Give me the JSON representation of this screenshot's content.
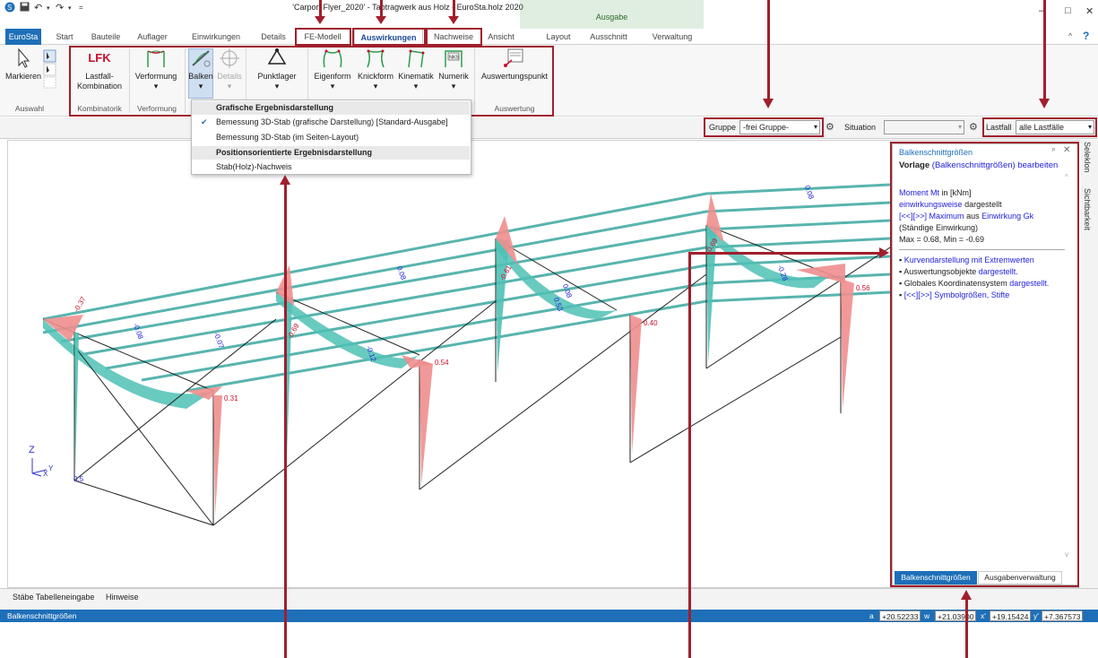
{
  "window": {
    "title": "'Carport Flyer_2020' - Tabtragwerk aus Holz - EuroSta.holz 2020",
    "ausgabe_group": "Ausgabe",
    "help": "?"
  },
  "tabs": [
    "EuroSta",
    "Start",
    "Bauteile",
    "Auflager",
    "Einwirkungen",
    "Details",
    "FE-Modell",
    "Auswirkungen",
    "Nachweise",
    "Ansicht",
    "Layout",
    "Ausschnitt",
    "Verwaltung"
  ],
  "ribbon": {
    "markieren": "Markieren",
    "auswahl": "Auswahl",
    "lfk_icon": "LFK",
    "lastfall_line1": "Lastfall-",
    "lastfall_line2": "Kombination",
    "kombinatorik": "Kombinatorik",
    "verformung": "Verformung",
    "verformung_group": "Verformung",
    "balken": "Balken",
    "details": "Details",
    "punktlager": "Punktlager",
    "eigenform": "Eigenform",
    "knickform": "Knickform",
    "kinematik": "Kinematik",
    "numerik": "Numerik",
    "nks_icon": "NKS",
    "auswertungspunkt": "Auswertungspunkt",
    "auswertung": "Auswertung"
  },
  "menu": {
    "hdr1": "Grafische Ergebnisdarstellung",
    "item1": "Bemessung 3D-Stab (grafische Darstellung) [Standard-Ausgabe]",
    "item2": "Bemessung 3D-Stab (im Seiten-Layout)",
    "hdr2": "Positionsorientierte Ergebnisdarstellung",
    "item3": "Stab(Holz)-Nachweis",
    "check": "✔"
  },
  "filter": {
    "gruppe_label": "Gruppe",
    "gruppe_value": "-frei Gruppe-",
    "situation_label": "Situation",
    "situation_value": "",
    "lastfall_label": "Lastfall",
    "lastfall_value": "alle Lastfälle"
  },
  "panel": {
    "title": "Balkenschnittgrößen",
    "vorlage_a": "Vorlage",
    "vorlage_b": "(Balkenschnittgrößen)",
    "vorlage_c": "bearbeiten",
    "line1a": "Moment Mt",
    "line1b": "in [kNm]",
    "line2a": "einwirkungsweise",
    "line2b": "dargestellt",
    "line3a": "[<<][>>]",
    "line3b": "Maximum",
    "line3c": "aus",
    "line3d": "Einwirkung Gk",
    "line4": "(Ständige Einwirkung)",
    "line5": "Max = 0.68, Min = -0.69",
    "b1": "Kurvendarstellung mit Extremwerten",
    "b2a": "Auswertungsobjekte",
    "b2b": "dargestellt.",
    "b3a": "Globales Koordinatensystem",
    "b3b": "dargestellt.",
    "b4a": "[<<][>>]",
    "b4b": "Symbolgrößen, Stifte",
    "tab1": "Balkenschnittgrößen",
    "tab2": "Ausgabenverwaltung"
  },
  "sidetabs": [
    "Seleklon",
    "Sichtbarkeit"
  ],
  "bottom": {
    "tab1": "Stäbe Tabelleneingabe",
    "tab2": "Hinweise"
  },
  "status": {
    "label": "Balkenschnittgrößen",
    "a_label": "a",
    "a": "+20.52233",
    "w_label": "w",
    "w": "+21.03900",
    "x_label": "x'",
    "x": "+19.15424",
    "y_label": "y'",
    "y": "+7.367573"
  },
  "axes": {
    "z": "Z",
    "y": "Y",
    "x": "X"
  },
  "annotations": [
    "-0.37",
    "-0.69",
    "-0.61",
    "-0.69",
    "0.68",
    "0.54",
    "0.31",
    "0.40",
    "0.56",
    "-0.08",
    "-0.07",
    "0.08",
    "-0.12",
    "0.53",
    "0.5",
    "-0.28"
  ]
}
